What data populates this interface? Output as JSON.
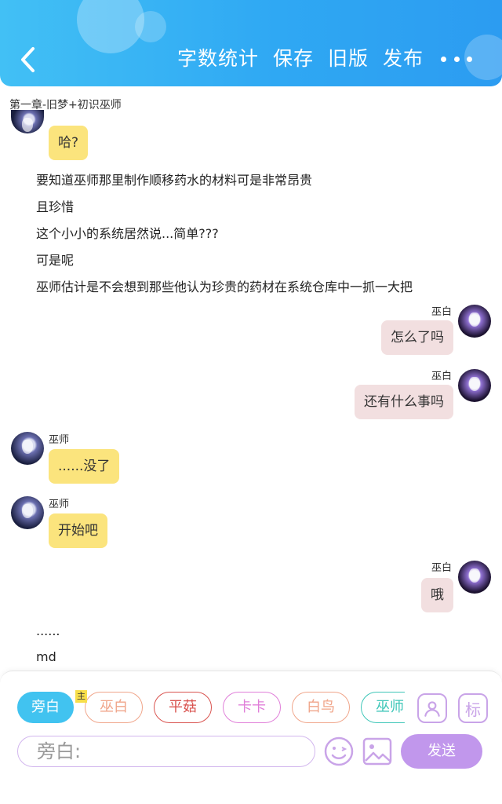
{
  "header": {
    "actions": [
      "字数统计",
      "保存",
      "旧版",
      "发布"
    ],
    "colors": {
      "gradient_start": "#42c0f5",
      "gradient_end": "#2c9cf1"
    }
  },
  "chapter_title": "第一章-旧梦+初识巫师",
  "chat": {
    "first_bubble": "哈?",
    "narration_1": [
      "要知道巫师那里制作顺移药水的材料可是非常昂贵",
      "且珍惜",
      "这个小小的系统居然说...简单???",
      "可是呢",
      "巫师估计是不会想到那些他认为珍贵的药材在系统仓库中一抓一大把"
    ],
    "msg_1": {
      "sender": "巫白",
      "text": "怎么了吗"
    },
    "msg_2": {
      "sender": "巫白",
      "text": "还有什么事吗"
    },
    "msg_3": {
      "sender": "巫师",
      "text": "......没了"
    },
    "msg_4": {
      "sender": "巫师",
      "text": "开始吧"
    },
    "msg_5": {
      "sender": "巫白",
      "text": "哦"
    },
    "narration_2": [
      "......",
      "md"
    ]
  },
  "composer": {
    "roles": [
      {
        "label": "旁白",
        "color": "#41c3f0"
      },
      {
        "label": "巫白",
        "color": "#f0a58a"
      },
      {
        "label": "平菇",
        "color": "#d9534f"
      },
      {
        "label": "卡卡",
        "color": "#e07fd9"
      },
      {
        "label": "白鸟",
        "color": "#f0a58a"
      },
      {
        "label": "巫师",
        "color": "#3ec6b8"
      }
    ],
    "main_tag": "主",
    "mark_label": "标",
    "input_placeholder": "旁白:",
    "send_label": "发送",
    "colors": {
      "accent": "#c197ec"
    }
  }
}
